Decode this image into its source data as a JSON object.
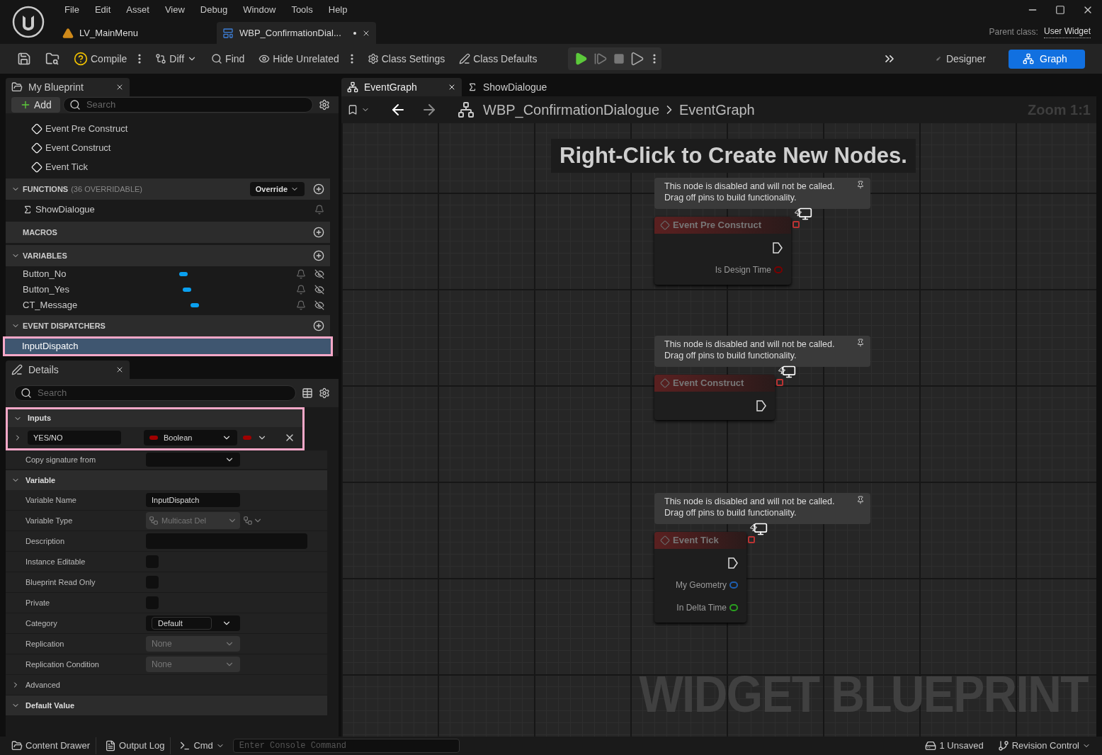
{
  "menu": [
    "File",
    "Edit",
    "Asset",
    "View",
    "Debug",
    "Window",
    "Tools",
    "Help"
  ],
  "document_tabs": [
    {
      "label": "LV_MainMenu",
      "kind": "level",
      "selected": false,
      "modified": false
    },
    {
      "label": "WBP_ConfirmationDial...",
      "kind": "widget",
      "selected": true,
      "modified": true
    }
  ],
  "parent_class": {
    "label": "Parent class:",
    "value": "User Widget"
  },
  "toolbar": [
    {
      "kind": "save",
      "more": false,
      "dropdown": false
    },
    {
      "kind": "browse",
      "more": false,
      "dropdown": false
    },
    {
      "kind": "compile",
      "label": "Compile",
      "more": true,
      "dropdown": false
    },
    {
      "kind": "diff",
      "label": "Diff",
      "more": false,
      "dropdown": true
    },
    {
      "kind": "find",
      "label": "Find",
      "more": false,
      "dropdown": false
    },
    {
      "kind": "hide",
      "label": "Hide Unrelated",
      "more": true,
      "dropdown": false
    },
    {
      "kind": "settings",
      "label": "Class Settings",
      "more": false,
      "dropdown": false
    },
    {
      "kind": "defaults",
      "label": "Class Defaults",
      "more": false,
      "dropdown": false
    }
  ],
  "play_controls": [
    {
      "kind": "play"
    },
    {
      "kind": "step"
    },
    {
      "kind": "stop"
    },
    {
      "kind": "eject"
    }
  ],
  "mode_buttons": [
    {
      "label": "Designer",
      "kind": "designer",
      "selected": false
    },
    {
      "label": "Graph",
      "kind": "graph",
      "selected": true
    }
  ],
  "my_blueprint": {
    "tab": "My Blueprint",
    "add": "Add",
    "search_placeholder": "Search",
    "events": [
      "Event Pre Construct",
      "Event Construct",
      "Event Tick"
    ],
    "sections": [
      {
        "title": "FUNCTIONS",
        "note": "(36 OVERRIDABLE)",
        "dropdown": "Override",
        "kind": "group",
        "items": [
          {
            "label": "ShowDialogue",
            "kind": "function",
            "selected": false,
            "highlighted": false
          }
        ]
      },
      {
        "title": "MACROS",
        "kind": "empty"
      },
      {
        "title": "VARIABLES",
        "kind": "group",
        "items": [
          {
            "label": "Button_No",
            "kind": "variable",
            "color": "#0aa0f0",
            "selected": false,
            "highlighted": false
          },
          {
            "label": "Button_Yes",
            "kind": "variable",
            "color": "#0aa0f0",
            "selected": false,
            "highlighted": false
          },
          {
            "label": "CT_Message",
            "kind": "variable",
            "color": "#0aa0f0",
            "selected": false,
            "highlighted": false
          }
        ]
      },
      {
        "title": "EVENT DISPATCHERS",
        "kind": "group",
        "items": [
          {
            "label": "InputDispatch",
            "kind": "dispatcher",
            "selected": true,
            "highlighted": true
          }
        ]
      }
    ]
  },
  "details": {
    "tab": "Details",
    "search_placeholder": "Search",
    "inputs": {
      "title": "Inputs",
      "highlighted": true,
      "params": [
        {
          "name": "YES/NO",
          "type": "Boolean",
          "color": "#a00000"
        }
      ]
    },
    "copy_signature": "Copy signature from",
    "variable": {
      "title": "Variable",
      "rows": [
        {
          "label": "Variable Name",
          "kind": "text",
          "value": "InputDispatch"
        },
        {
          "label": "Variable Type",
          "kind": "type",
          "value": "Multicast Del"
        },
        {
          "label": "Description",
          "kind": "textarea"
        },
        {
          "label": "Instance Editable",
          "kind": "checkbox",
          "checked": false
        },
        {
          "label": "Blueprint Read Only",
          "kind": "checkbox",
          "checked": false
        },
        {
          "label": "Private",
          "kind": "checkbox",
          "checked": false
        },
        {
          "label": "Category",
          "kind": "category",
          "value": "Default"
        },
        {
          "label": "Replication",
          "kind": "dropdown",
          "value": "None"
        },
        {
          "label": "Replication Condition",
          "kind": "dropdown",
          "value": "None"
        }
      ]
    },
    "sections": [
      {
        "title": "Advanced",
        "expanded": false
      },
      {
        "title": "Default Value",
        "expanded": true
      }
    ]
  },
  "graph": {
    "tabs": [
      {
        "label": "EventGraph",
        "kind": "graph",
        "selected": true,
        "closable": true
      },
      {
        "label": "ShowDialogue",
        "kind": "function",
        "selected": false,
        "closable": false
      }
    ],
    "breadcrumb": [
      "WBP_ConfirmationDialogue",
      "EventGraph"
    ],
    "zoom": "Zoom 1:1",
    "hint": "Right-Click to Create New Nodes.",
    "nodes": [
      {
        "title": "Event Pre Construct",
        "comment": "This node is disabled and will not be called.\nDrag off pins to build functionality.",
        "pins": [
          {
            "kind": "exec"
          },
          {
            "kind": "bool",
            "label": "Is Design Time"
          }
        ]
      },
      {
        "title": "Event Construct",
        "comment": "This node is disabled and will not be called.\nDrag off pins to build functionality.",
        "pins": [
          {
            "kind": "exec"
          }
        ]
      },
      {
        "title": "Event Tick",
        "comment": "This node is disabled and will not be called.\nDrag off pins to build functionality.",
        "pins": [
          {
            "kind": "exec"
          },
          {
            "kind": "struct",
            "label": "My Geometry"
          },
          {
            "kind": "float",
            "label": "In Delta Time"
          }
        ]
      }
    ],
    "watermark": "WIDGET BLUEPRINT"
  },
  "status_bar": {
    "buttons": [
      {
        "kind": "drawer",
        "label": "Content Drawer"
      },
      {
        "kind": "log",
        "label": "Output Log"
      }
    ],
    "cmd": "Cmd",
    "console_placeholder": "Enter Console Command",
    "unsaved": "1 Unsaved",
    "revision": "Revision Control"
  }
}
